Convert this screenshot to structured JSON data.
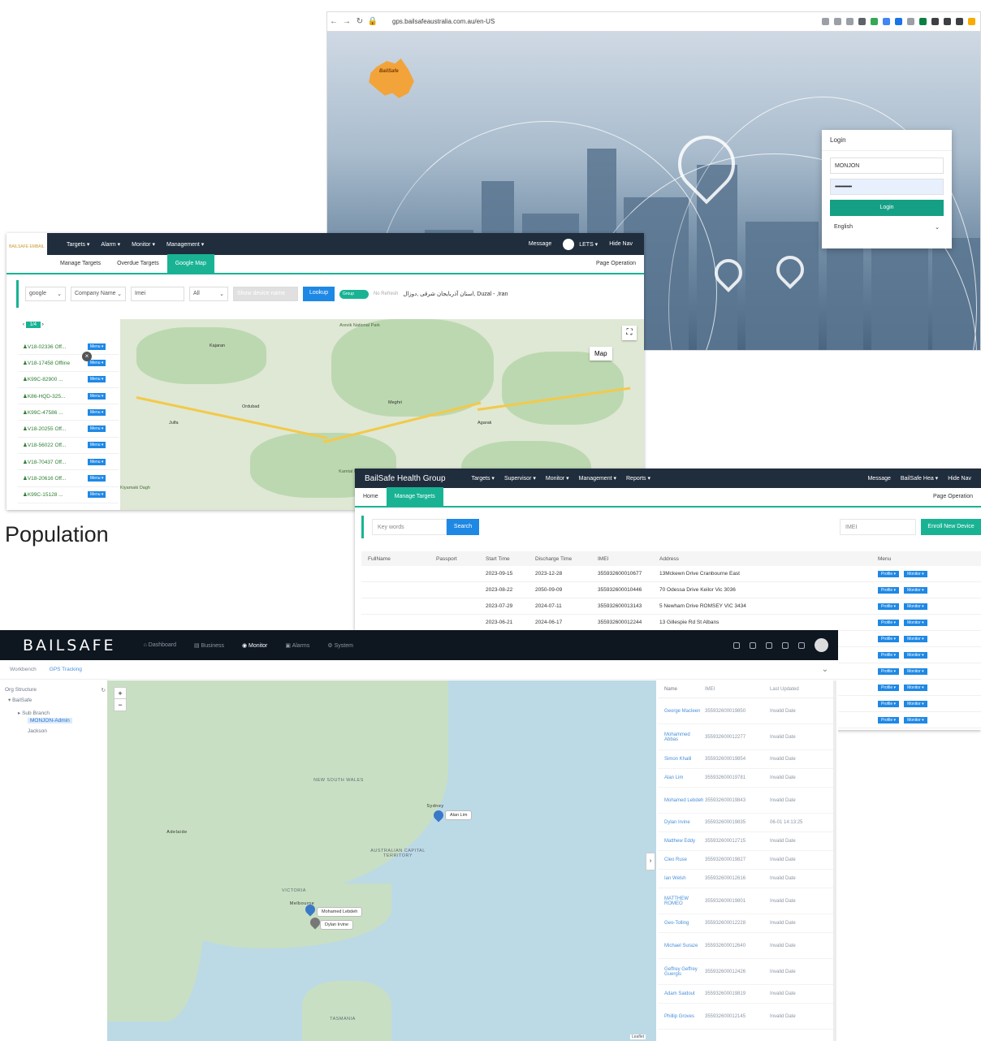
{
  "login_window": {
    "url": "gps.bailsafeaustralia.com.au/en-US",
    "logo_text": "BailSafe",
    "card_title": "Login",
    "username": "MONJON",
    "password_mask": "••••••••••••••",
    "login_button": "Login",
    "language": "English"
  },
  "map_window": {
    "nav": {
      "items": [
        "Targets ▾",
        "Alarm ▾",
        "Monitor ▾",
        "Management ▾"
      ],
      "message": "Message",
      "user": "LETS ▾",
      "hide_nav": "Hide Nav",
      "logo_text": "BAILSAFE EMBAIL"
    },
    "tabs": [
      "Manage Targets",
      "Overdue Targets",
      "Google Map"
    ],
    "page_operation": "Page Operation",
    "filters": {
      "map_provider": "google",
      "company": "Company Name",
      "imei_placeholder": "Imei",
      "status": "All",
      "device_placeholder": "Show device name",
      "lookup_button": "Lookup",
      "group_toggle": "Group",
      "refresh_label": "No Refresh",
      "location_text": "استان آذربایجان شرقی ,دوزال, Duzal - ,Iran"
    },
    "pager": "1/4",
    "map_type_button": "Map",
    "targets": [
      "V18-02336 Off...",
      "V18-17458 Offline",
      "K99C-82900 ...",
      "K86-HQD-325...",
      "K99C-47586 ...",
      "V18-20255 Off...",
      "V18-56022 Off...",
      "V18-70437 Off...",
      "V18-20616 Off...",
      "K99C-15128 ..."
    ],
    "menu_label": "Menu ▾",
    "map_labels": [
      "Arevik National Park",
      "Kamtal National Park",
      "Kiyamaki Dagh",
      "Meghri",
      "Ordubad",
      "Kajaran",
      "Agarak",
      "Julfa"
    ]
  },
  "manage_window": {
    "brand": "BailSafe Health Group",
    "nav": [
      "Targets ▾",
      "Supervisor ▾",
      "Monitor ▾",
      "Management ▾",
      "Reports ▾"
    ],
    "message": "Message",
    "user": "BailSafe Hea ▾",
    "hide_nav": "Hide Nav",
    "tabs": [
      "Home",
      "Manage Targets"
    ],
    "page_operation": "Page Operation",
    "keywords_placeholder": "Key words",
    "search_button": "Search",
    "imei_placeholder": "IMEI",
    "enroll_button": "Enroll New Device",
    "columns": [
      "FullName",
      "Passport",
      "Start Time",
      "Discharge Time",
      "IMEI",
      "Address",
      "Menu"
    ],
    "rows": [
      {
        "start": "2023-09-15",
        "discharge": "2023-12-28",
        "imei": "355932600010677",
        "address": "13Mckewn Drive Cranbourne East"
      },
      {
        "start": "2023-08-22",
        "discharge": "2050-09-09",
        "imei": "355932600010446",
        "address": "70 Odessa Drive Keilor Vic 3036"
      },
      {
        "start": "2023-07-29",
        "discharge": "2024-07-11",
        "imei": "355932600013143",
        "address": "5 Newham Drive ROMSEY VIC 3434"
      },
      {
        "start": "2023-06-21",
        "discharge": "2024-06-17",
        "imei": "355932600012244",
        "address": "13 Gillespie Rd St Albans"
      }
    ],
    "profile_label": "Profile ▾",
    "monitor_label": "Monitor ▾"
  },
  "gps_window": {
    "brand": "BAILSAFE",
    "nav": [
      "Dashboard",
      "Business",
      "Monitor",
      "Alarms",
      "System"
    ],
    "active_nav": "Monitor",
    "breadcrumbs": [
      "Workbench",
      "GPS Tracking"
    ],
    "org_title": "Org Structure",
    "org_items": [
      "BailSafe",
      "Sub Branch",
      "MONJON-Admin",
      "Jackson"
    ],
    "map_labels": [
      "NEW SOUTH WALES",
      "AUSTRALIAN CAPITAL TERRITORY",
      "VICTORIA",
      "TASMANIA",
      "Sydney",
      "Adelaide",
      "Melbourne"
    ],
    "map_markers": [
      "Alan Lim",
      "Mohamed Lebdeh",
      "Dylan Irvine"
    ],
    "list_columns": [
      "Name",
      "IMEI",
      "Last Updated"
    ],
    "list_rows": [
      {
        "name": "George Macleen",
        "imei": "355932600019850",
        "updated": "Invalid Date"
      },
      {
        "name": "Mohammed Abbas",
        "imei": "355932600012277",
        "updated": "Invalid Date"
      },
      {
        "name": "Simon Khalil",
        "imei": "355932600019854",
        "updated": "Invalid Date"
      },
      {
        "name": "Alan Lim",
        "imei": "355932600019781",
        "updated": "Invalid Date"
      },
      {
        "name": "Mohamed Lebdeh",
        "imei": "355932600019843",
        "updated": "Invalid Date"
      },
      {
        "name": "Dylan Irvine",
        "imei": "355932600019835",
        "updated": "06-01 14:13:25"
      },
      {
        "name": "Matthew Eddy",
        "imei": "355932600012715",
        "updated": "Invalid Date"
      },
      {
        "name": "Cleo Ruse",
        "imei": "355932600019827",
        "updated": "Invalid Date"
      },
      {
        "name": "Ian Welsh",
        "imei": "355932600012616",
        "updated": "Invalid Date"
      },
      {
        "name": "MATTHEW ROMEO",
        "imei": "355932600019801",
        "updated": "Invalid Date"
      },
      {
        "name": "Geo-Tolling",
        "imei": "355932600012228",
        "updated": "Invalid Date"
      },
      {
        "name": "Michael Suraze",
        "imei": "355932600012640",
        "updated": "Invalid Date"
      },
      {
        "name": "Geffrey Geffrey Guergis",
        "imei": "355932600012426",
        "updated": "Invalid Date"
      },
      {
        "name": "Adam Saidout",
        "imei": "355932600019819",
        "updated": "Invalid Date"
      },
      {
        "name": "Phillip Groves",
        "imei": "355932600012145",
        "updated": "Invalid Date"
      }
    ],
    "attribution": "Leaflet"
  },
  "caption": "Population",
  "colors": {
    "accent_teal": "#19b394",
    "button_blue": "#1e88e5",
    "nav_dark": "#1f2d3d",
    "gps_nav": "#0e1620"
  }
}
